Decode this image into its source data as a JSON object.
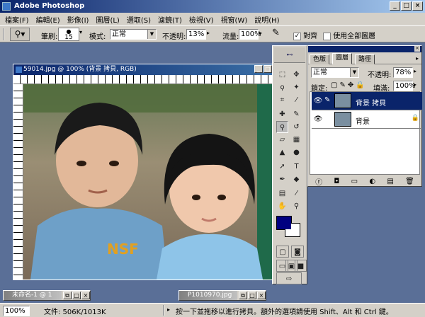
{
  "app": {
    "title": "Adobe Photoshop"
  },
  "menu": [
    "檔案(F)",
    "編輯(E)",
    "影像(I)",
    "圖層(L)",
    "選取(S)",
    "濾鏡(T)",
    "檢視(V)",
    "視窗(W)",
    "說明(H)"
  ],
  "options": {
    "brush_label": "筆刷:",
    "brush_size": "15",
    "mode_label": "模式:",
    "mode_value": "正常",
    "opacity_label": "不透明:",
    "opacity_value": "13%",
    "flow_label": "流量:",
    "flow_value": "100%",
    "aligned_label": "對齊",
    "use_all_layers_label": "使用全部圖層",
    "aligned_checked": true,
    "use_all_layers_checked": false
  },
  "document": {
    "title": "59014.jpg @ 100% (背景 拷貝, RGB)",
    "photo_text": "NSF"
  },
  "layers_panel": {
    "tabs": [
      "色版",
      "圖層",
      "路徑"
    ],
    "active_tab": "圖層",
    "blend_mode": "正常",
    "opacity_label": "不透明:",
    "opacity_value": "78%",
    "lock_label": "鎖定:",
    "fill_label": "填滿:",
    "fill_value": "100%",
    "layers": [
      {
        "name": "背景 拷貝",
        "selected": true
      },
      {
        "name": "背景",
        "selected": false
      }
    ]
  },
  "minimized": [
    {
      "title": "未命名-1 @ 1"
    },
    {
      "title": "P1010970.jpg"
    }
  ],
  "status": {
    "zoom": "100%",
    "doc_info": "文件: 506K/1013K",
    "hint": "按一下並拖移以進行拷貝。額外的選項請使用 Shift、Alt 和 Ctrl 鍵。"
  },
  "colors": {
    "foreground": "#000080",
    "background": "#ffffff",
    "titlebar": "#0a246a",
    "chrome": "#d4d0c8",
    "workspace": "#5a6f97"
  }
}
